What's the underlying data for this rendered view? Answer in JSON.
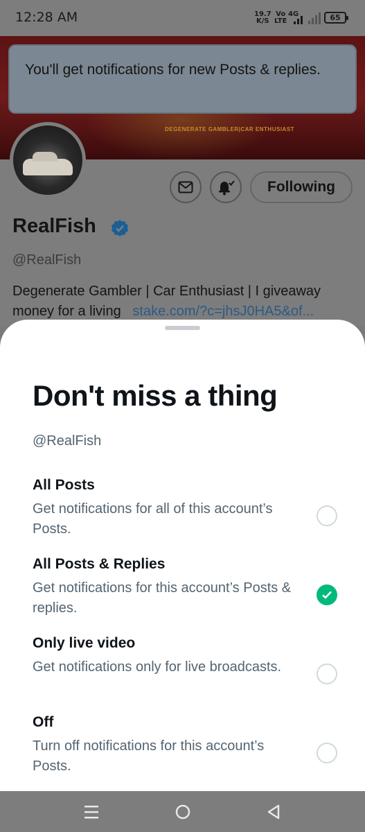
{
  "status_bar": {
    "time": "12:28 AM",
    "net_speed_value": "19.7",
    "net_speed_unit": "K/S",
    "volte_top": "Vo",
    "volte_bottom": "LTE",
    "network_type": "4G",
    "battery_level": "65"
  },
  "banner": {
    "tagline": "DEGENERATE GAMBLER|CAR ENTHUSIAST"
  },
  "toast": {
    "message": "You'll get notifications for new Posts & replies."
  },
  "profile": {
    "display_name": "RealFish",
    "handle": "@RealFish",
    "bio_text": "Degenerate Gambler | Car Enthusiast | I giveaway money for a living",
    "bio_link": "stake.com/?c=jhsJ0HA5&of...",
    "following_label": "Following"
  },
  "sheet": {
    "title": "Don't miss a thing",
    "subtitle": "@RealFish",
    "options": [
      {
        "title": "All Posts",
        "description": "Get notifications for all of this account’s Posts.",
        "selected": false
      },
      {
        "title": "All Posts & Replies",
        "description": "Get notifications for this account’s Posts & replies.",
        "selected": true
      },
      {
        "title": "Only live video",
        "description": "Get notifications only for live broadcasts.",
        "selected": false
      },
      {
        "title": "Off",
        "description": "Turn off notifications for this account’s Posts.",
        "selected": false
      }
    ]
  },
  "colors": {
    "verified_blue": "#1d9bf0",
    "selected_green": "#00ba7c",
    "secondary_text": "#536471",
    "primary_text": "#0f1419"
  },
  "icons": [
    "mail-icon",
    "bell-check-icon",
    "verified-badge-icon",
    "menu-nav-icon",
    "home-nav-icon",
    "back-nav-icon",
    "checkmark-icon"
  ]
}
